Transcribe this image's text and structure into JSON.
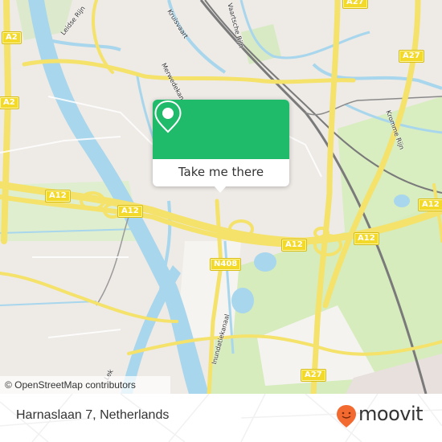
{
  "map": {
    "colors": {
      "background": "#eeeae6",
      "water": "#a8d6ec",
      "park": "#d4ebb9",
      "motorway": "#f4e26a",
      "rail": "#7a7a7a",
      "shield": "#f2d92a"
    },
    "road_shields": [
      {
        "label": "A2",
        "name": "shield-a2-top"
      },
      {
        "label": "A2",
        "name": "shield-a2-bottom"
      },
      {
        "label": "A27",
        "name": "shield-a27-top"
      },
      {
        "label": "A27",
        "name": "shield-a27-mid"
      },
      {
        "label": "A12",
        "name": "shield-a12-west"
      },
      {
        "label": "A12",
        "name": "shield-a12-center"
      },
      {
        "label": "A12",
        "name": "shield-a12-east"
      },
      {
        "label": "A12",
        "name": "shield-a12-far-east"
      },
      {
        "label": "A12",
        "name": "shield-a12-right"
      },
      {
        "label": "N408",
        "name": "shield-n408"
      },
      {
        "label": "A27",
        "name": "shield-a27-bottom"
      }
    ],
    "street_labels": [
      {
        "label": "Leidse Rijn"
      },
      {
        "label": "Kruisvaart"
      },
      {
        "label": "Merwedekanaal"
      },
      {
        "label": "Vaartsche Rijn"
      },
      {
        "label": "Kromme Rijn"
      },
      {
        "label": "Inundatiekanaal"
      },
      {
        "label": "Lek"
      }
    ],
    "attribution": "© OpenStreetMap contributors"
  },
  "popup": {
    "accent": "#1fba6a",
    "icon": "map-pin-icon",
    "button_label": "Take me there"
  },
  "footer": {
    "address": "Harnaslaan 7, Netherlands",
    "brand_name": "moovit",
    "brand_color": "#f26a30",
    "brand_icon": "moovit-smile-pin-icon"
  }
}
